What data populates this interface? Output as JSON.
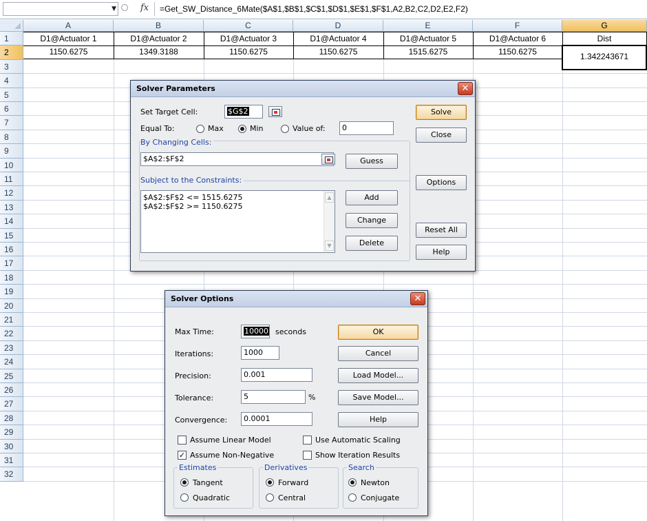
{
  "formula_bar": {
    "name_box": "",
    "fx_label": "fx",
    "formula": "=Get_SW_Distance_6Mate($A$1,$B$1,$C$1,$D$1,$E$1,$F$1,A2,B2,C2,D2,E2,F2)"
  },
  "sheet": {
    "columns": [
      "A",
      "B",
      "C",
      "D",
      "E",
      "F",
      "G"
    ],
    "selected_column": "G",
    "rows": [
      "1",
      "2",
      "3",
      "4",
      "5",
      "6",
      "7",
      "8",
      "9",
      "10",
      "11",
      "12",
      "13",
      "14",
      "15",
      "16",
      "17",
      "18",
      "19",
      "20",
      "21",
      "22",
      "23",
      "24",
      "25",
      "26",
      "27",
      "28",
      "29",
      "30",
      "31",
      "32"
    ],
    "selected_row": "2",
    "row1": [
      "D1@Actuator 1",
      "D1@Actuator 2",
      "D1@Actuator 3",
      "D1@Actuator 4",
      "D1@Actuator 5",
      "D1@Actuator 6",
      "Dist"
    ],
    "row2": [
      "1150.6275",
      "1349.3188",
      "1150.6275",
      "1150.6275",
      "1515.6275",
      "1150.6275",
      "1.342243671"
    ]
  },
  "solver_parameters": {
    "title": "Solver Parameters",
    "close_glyph": "✕",
    "set_target_label": "Set Target Cell:",
    "target_value": "$G$2",
    "equal_to_label": "Equal To:",
    "max_label": "Max",
    "min_label": "Min",
    "value_of_label": "Value of:",
    "value_of": "0",
    "selected_option": "Min",
    "changing_cells_label": "By Changing Cells:",
    "changing_cells_value": "$A$2:$F$2",
    "constraints_label": "Subject to the Constraints:",
    "constraints": [
      "$A$2:$F$2 <= 1515.6275",
      "$A$2:$F$2 >= 1150.6275"
    ],
    "buttons": {
      "solve": "Solve",
      "close": "Close",
      "guess": "Guess",
      "options": "Options",
      "add": "Add",
      "change": "Change",
      "reset_all": "Reset All",
      "delete": "Delete",
      "help": "Help"
    }
  },
  "solver_options": {
    "title": "Solver Options",
    "close_glyph": "✕",
    "max_time_label": "Max Time:",
    "max_time_value": "10000",
    "seconds_label": "seconds",
    "iterations_label": "Iterations:",
    "iterations_value": "1000",
    "precision_label": "Precision:",
    "precision_value": "0.001",
    "tolerance_label": "Tolerance:",
    "tolerance_value": "5",
    "percent_label": "%",
    "convergence_label": "Convergence:",
    "convergence_value": "0.0001",
    "checkboxes": {
      "linear_model": "Assume Linear Model",
      "linear_model_checked": false,
      "automatic_scaling": "Use Automatic Scaling",
      "automatic_scaling_checked": false,
      "non_negative": "Assume Non-Negative",
      "non_negative_checked": true,
      "iteration_results": "Show Iteration Results",
      "iteration_results_checked": false
    },
    "estimates": {
      "label": "Estimates",
      "tangent": "Tangent",
      "quadratic": "Quadratic",
      "selected": "Tangent"
    },
    "derivatives": {
      "label": "Derivatives",
      "forward": "Forward",
      "central": "Central",
      "selected": "Forward"
    },
    "search": {
      "label": "Search",
      "newton": "Newton",
      "conjugate": "Conjugate",
      "selected": "Newton"
    },
    "buttons": {
      "ok": "OK",
      "cancel": "Cancel",
      "load_model": "Load Model...",
      "save_model": "Save Model...",
      "help": "Help"
    },
    "check_glyph": "✓"
  },
  "colors": {
    "header_bg": "#dbe5f1",
    "selected_header_bg": "#f1c15f",
    "gridline": "#d0d7e5",
    "dialog_bg": "#ecedef",
    "close_red": "#c73a1f",
    "label_blue": "#1c45a6"
  }
}
